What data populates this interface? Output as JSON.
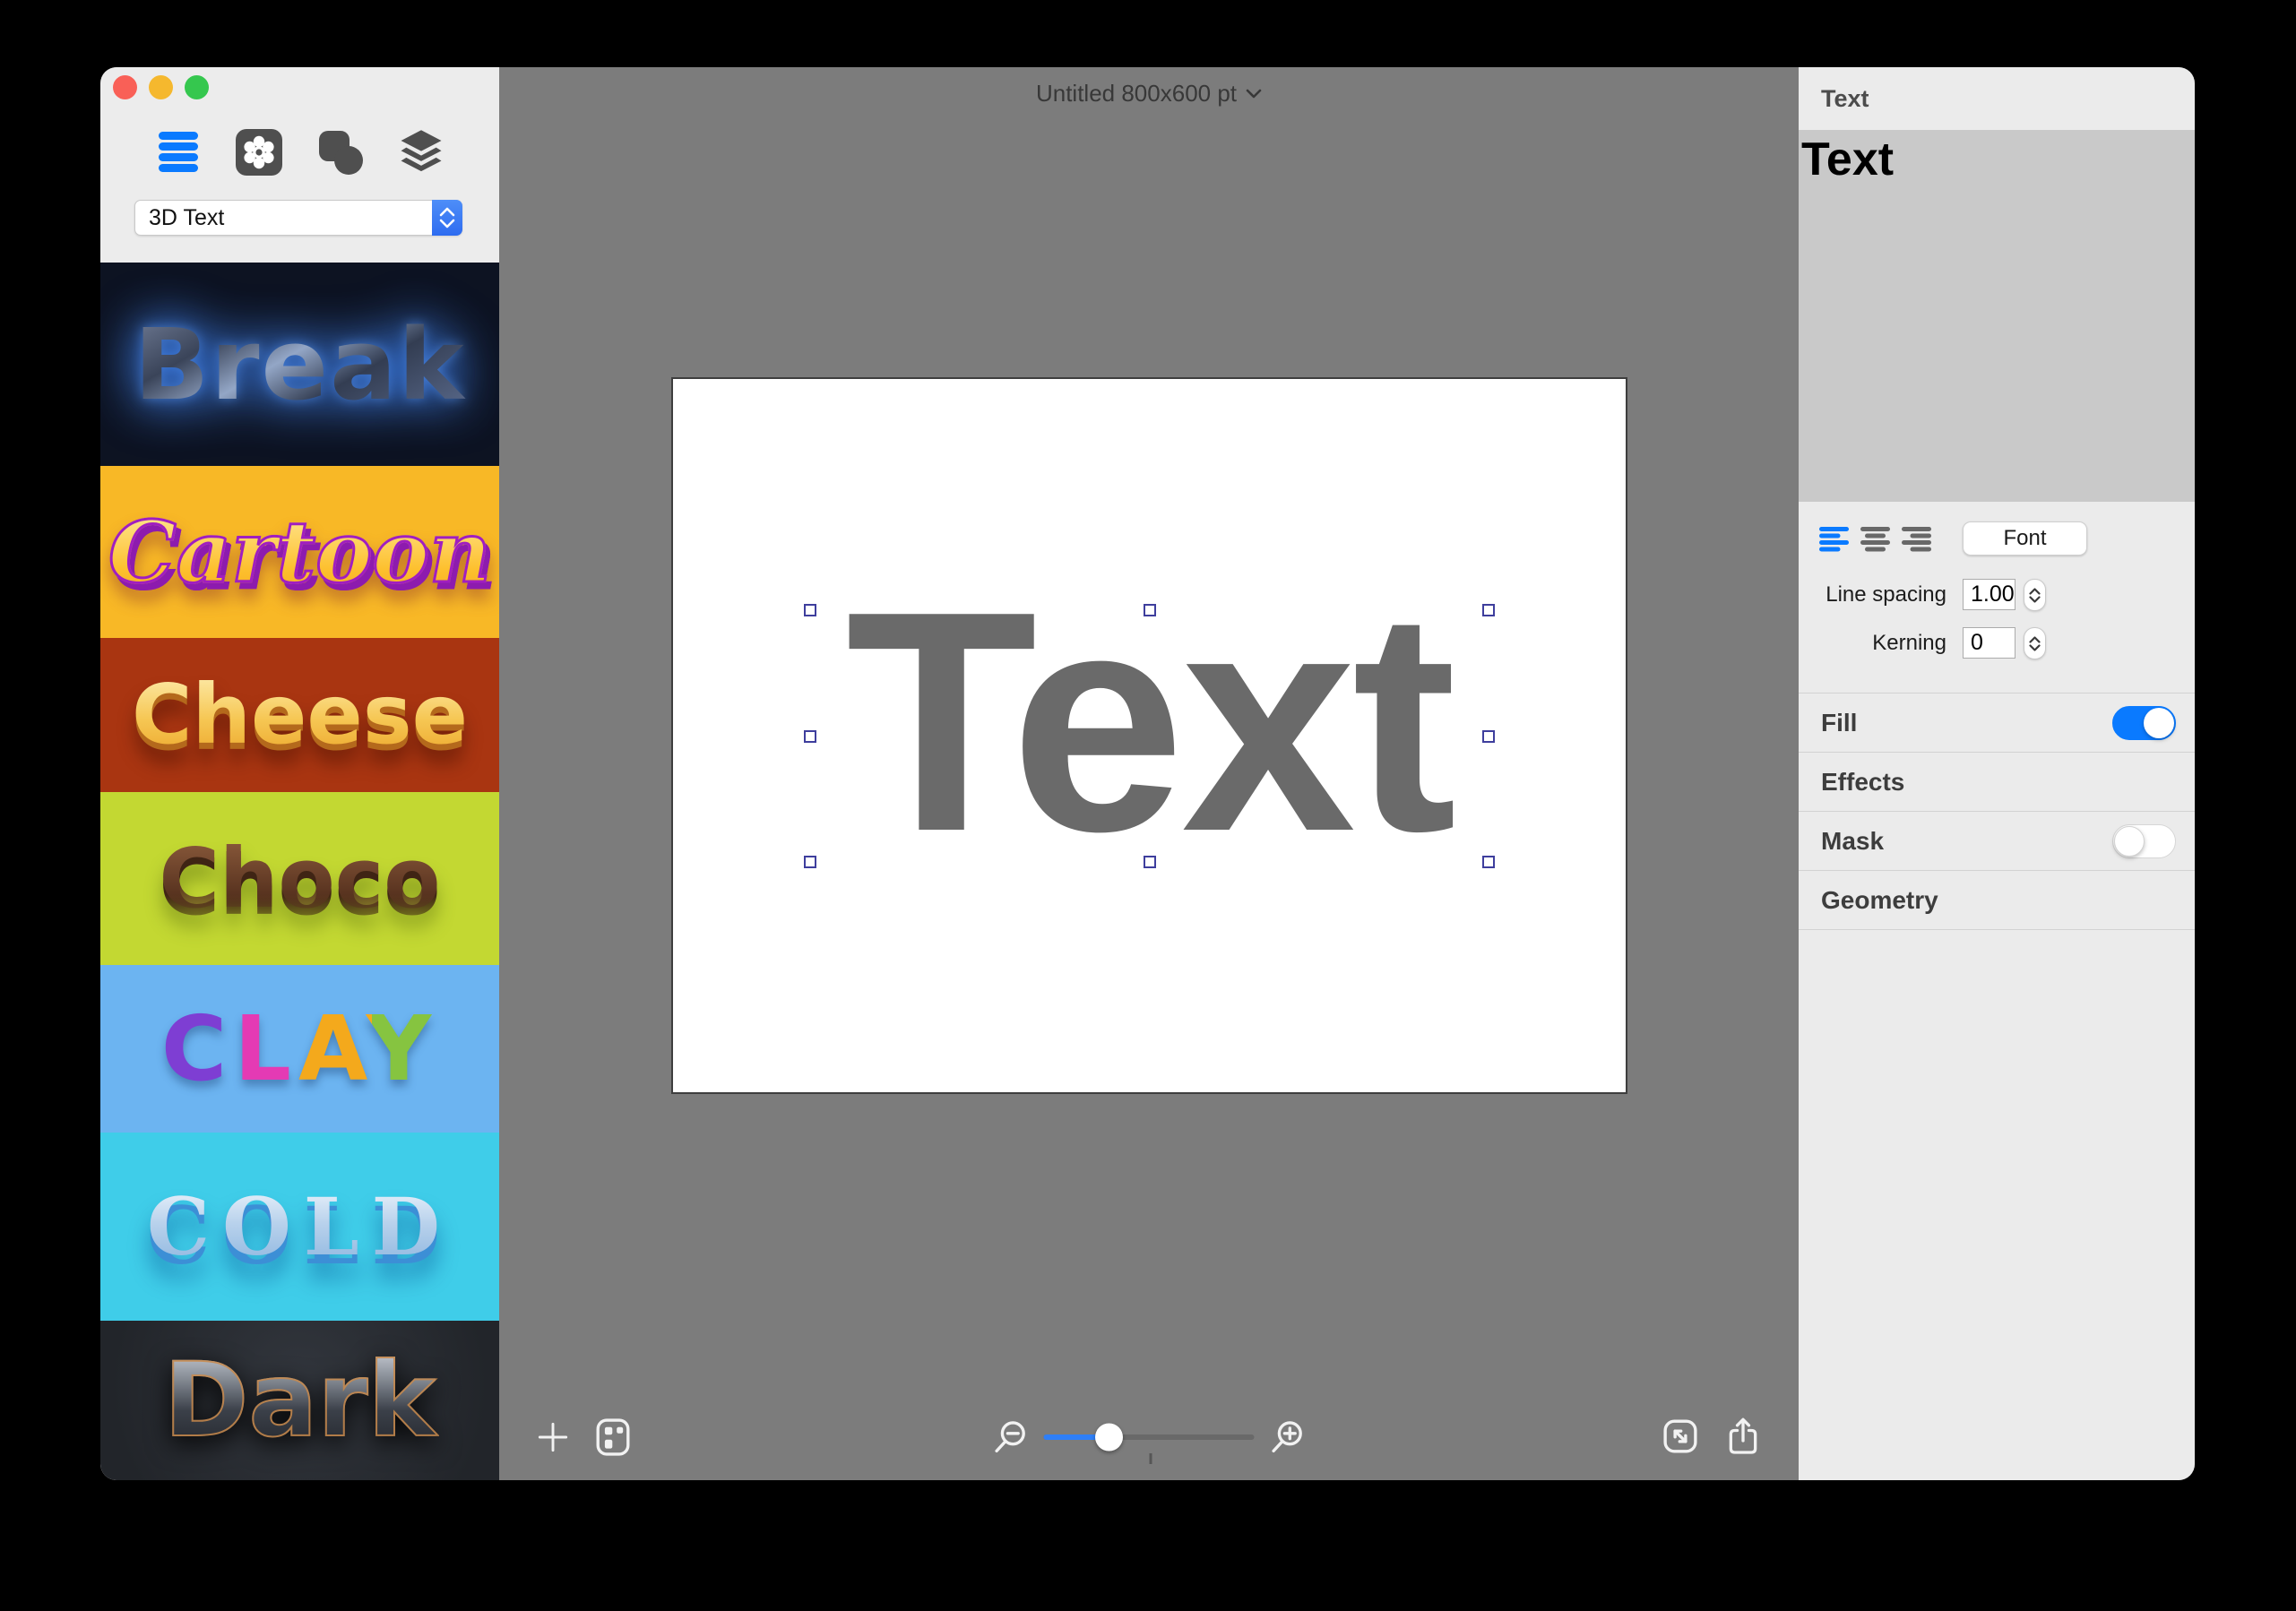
{
  "window": {
    "title": "Untitled 800x600 pt"
  },
  "sidebar": {
    "dropdown": {
      "value": "3D Text"
    },
    "toolbar_icons": [
      "text-list-icon",
      "effects-flower-icon",
      "shapes-icon",
      "layers-icon"
    ],
    "styles": [
      {
        "label": "Break",
        "bg": "#0d1322",
        "text_style": "shattered-steel-blue-glow"
      },
      {
        "label": "Cartoon",
        "bg": "#f8b826",
        "text_style": "yellow-script-purple-outline"
      },
      {
        "label": "Cheese",
        "bg": "#a93511",
        "text_style": "cheese-yellow-3d"
      },
      {
        "label": "Choco",
        "bg": "#c3d832",
        "text_style": "chocolate-drizzle"
      },
      {
        "label": "CLAY",
        "bg": "#6cb4f1",
        "text_style": "multicolor-clay"
      },
      {
        "label": "COLD",
        "bg": "#3fcde9",
        "text_style": "ice-blue-slab"
      },
      {
        "label": "Dark",
        "bg": "#282b31",
        "text_style": "dark-metal-copper-outline"
      }
    ]
  },
  "canvas": {
    "text": "Text",
    "text_color": "#6a6a6a",
    "background": "#7c7c7c",
    "artboard_color": "#ffffff",
    "zoom_slider": {
      "thumb_fraction": 0.31,
      "center_tick_fraction": 0.5
    },
    "bottom_icons": [
      "add-icon",
      "gallery-icon",
      "zoom-out-icon",
      "zoom-in-icon",
      "resize-icon",
      "share-icon"
    ]
  },
  "inspector": {
    "header": "Text",
    "content": "Text",
    "font_button": "Font",
    "alignment": {
      "options": [
        "left",
        "center",
        "right"
      ],
      "active": "left"
    },
    "line_spacing": {
      "label": "Line spacing",
      "value": "1.00"
    },
    "kerning": {
      "label": "Kerning",
      "value": "0"
    },
    "sections": [
      {
        "label": "Fill",
        "toggle": "on"
      },
      {
        "label": "Effects"
      },
      {
        "label": "Mask",
        "toggle": "off"
      },
      {
        "label": "Geometry"
      }
    ],
    "accent_color": "#0a7aff"
  }
}
